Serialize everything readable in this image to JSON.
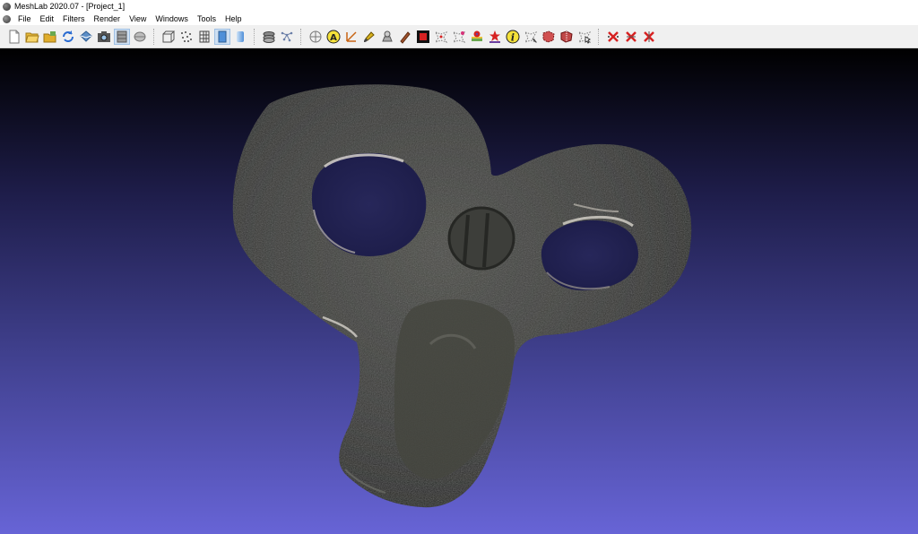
{
  "window": {
    "title": "MeshLab 2020.07 - [Project_1]"
  },
  "menubar": {
    "items": [
      "File",
      "Edit",
      "Filters",
      "Render",
      "View",
      "Windows",
      "Tools",
      "Help"
    ]
  },
  "toolbar": {
    "groups": [
      [
        "new-icon",
        "open-icon",
        "open-project-icon",
        "reload-icon",
        "export-mesh-icon",
        "snapshot-icon",
        "layer-icon",
        "raster-icon"
      ],
      [
        "bbox-icon",
        "points-icon",
        "wireframe-icon",
        "flat-icon",
        "smooth-icon"
      ],
      [
        "stack-icon",
        "align-icon"
      ],
      [
        "manipulator-icon",
        "annotation-a-icon",
        "measure-icon",
        "paint-icon",
        "z-paint-icon",
        "texture-icon",
        "select-vertices-icon",
        "select-faces-icon",
        "color-paint-icon",
        "georef-icon",
        "info-icon",
        "point-picker-icon",
        "select-connected-icon",
        "select-region-icon",
        "pick-icon"
      ],
      [
        "delete-vertices-icon",
        "delete-faces-icon",
        "delete-all-icon"
      ]
    ],
    "active": [
      "layer-icon",
      "flat-icon"
    ]
  },
  "viewport": {
    "background_top": "#000000",
    "background_bottom": "#6764d6",
    "mesh_color": "#353633"
  }
}
